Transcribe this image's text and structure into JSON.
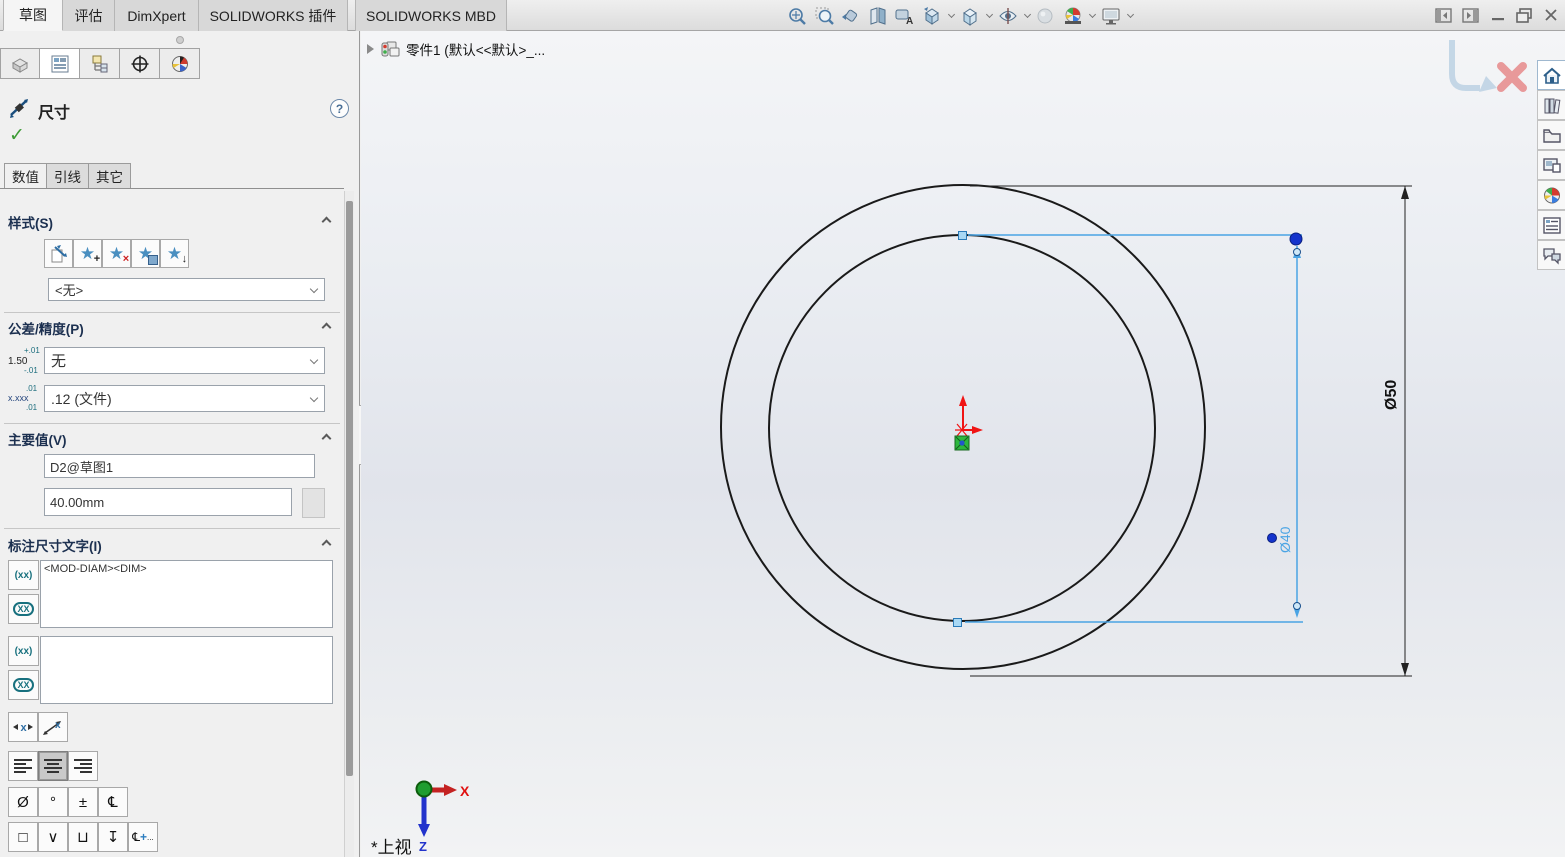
{
  "window_controls": {
    "icons": [
      "collapse-pane-left",
      "collapse-pane-right",
      "minimize",
      "restore",
      "close"
    ]
  },
  "ribbon": {
    "tabs": [
      {
        "label": "草图",
        "active": true
      },
      {
        "label": "评估",
        "active": false
      },
      {
        "label": "DimXpert",
        "active": false
      },
      {
        "label": "SOLIDWORKS 插件",
        "active": false
      },
      {
        "label": "SOLIDWORKS MBD",
        "active": false
      }
    ],
    "view_toolbar_icons": [
      "zoom-to-fit",
      "zoom-to-area",
      "previous-view",
      "section-view",
      "annotation-view",
      "view-orientation",
      "display-style",
      "hide-show-items",
      "edit-appearance",
      "apply-scene",
      "view-settings"
    ]
  },
  "property_manager": {
    "panel_tab_icons": [
      "part-icon",
      "property-manager-icon",
      "configurations-icon",
      "dimxpert-icon",
      "appearances-icon"
    ],
    "title": "尺寸",
    "help": "?",
    "ok_check": "✓",
    "tabs": [
      {
        "label": "数值",
        "active": true
      },
      {
        "label": "引线",
        "active": false
      },
      {
        "label": "其它",
        "active": false
      }
    ],
    "style_section": {
      "title": "样式(S)",
      "doc_glyph": "⇄",
      "star": "★",
      "add": "+",
      "delete": "×",
      "load": "↓",
      "selected": "<无>"
    },
    "tolerance_section": {
      "title": "公差/精度(P)",
      "tol_icon": {
        "main": "1.50",
        "top": "+.01",
        "bottom": "-.01"
      },
      "tolerance_type": "无",
      "prec_icon": {
        "main": "x.xxx",
        "top": ".01",
        "bottom": ".01"
      },
      "precision": ".12 (文件)"
    },
    "primary_section": {
      "title": "主要值(V)",
      "name": "D2@草图1",
      "value": "40.00mm"
    },
    "dim_text_section": {
      "title": "标注尺寸文字(I)",
      "paren_icon": "(xx)",
      "oval_icon": "XX",
      "template": "<MOD-DIAM><DIM>",
      "template2": "",
      "icon_x": "x"
    },
    "symbols": {
      "row1": [
        "Ø",
        "°",
        "±",
        "℄"
      ],
      "row2": [
        "□",
        "∨",
        "⊔",
        "↧"
      ],
      "more_cl": "℄",
      "more_plus": "+",
      "more_dots": "..."
    }
  },
  "viewport": {
    "tree_item": {
      "label": "零件1  (默认<<默认>_..."
    },
    "dimensions": {
      "outer": "Ø50",
      "inner": "Ø40"
    },
    "triad": {
      "x": "X",
      "z": "Z"
    },
    "view_label": "*上视"
  },
  "task_pane_icons": [
    "home",
    "design-library",
    "file-explorer",
    "view-palette",
    "appearances",
    "custom-properties",
    "forum"
  ],
  "colors": {
    "selection_blue": "#4aa4e4",
    "grip_blue": "#1433cc",
    "origin_red": "#f01414",
    "point_green": "#2db83d",
    "accent": "#4a8fc0"
  }
}
